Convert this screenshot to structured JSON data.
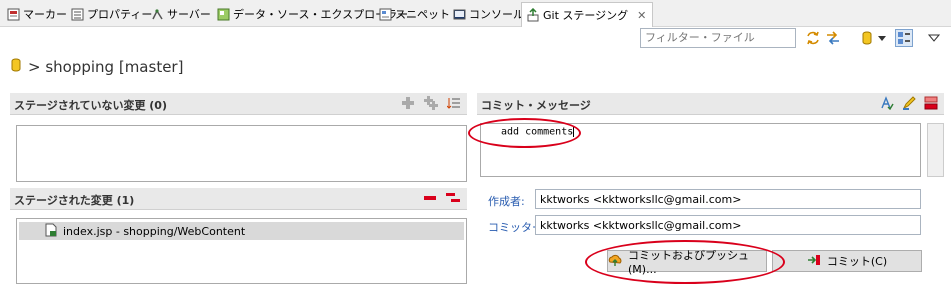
{
  "tabs": [
    {
      "label": "マーカー",
      "icon": "markers-icon"
    },
    {
      "label": "プロパティー",
      "icon": "properties-icon"
    },
    {
      "label": "サーバー",
      "icon": "servers-icon"
    },
    {
      "label": "データ・ソース・エクスプローラー",
      "icon": "data-source-icon"
    },
    {
      "label": "スニペット",
      "icon": "snippets-icon"
    },
    {
      "label": "コンソール",
      "icon": "console-icon"
    },
    {
      "label": "Git ステージング",
      "icon": "git-staging-icon",
      "active": true
    }
  ],
  "filter": {
    "placeholder": "フィルター・ファイル"
  },
  "repository": {
    "label": "> shopping [master]"
  },
  "unstaged": {
    "title": "ステージされていない変更 (0)"
  },
  "staged": {
    "title": "ステージされた変更 (1)",
    "items": [
      {
        "label": "index.jsp - shopping/WebContent"
      }
    ]
  },
  "commit": {
    "title": "コミット・メッセージ",
    "message": "add comments",
    "author_label": "作成者:",
    "author_value": "kktworks <kktworksllc@gmail.com>",
    "committer_label": "コミッター:",
    "committer_value": "kktworks <kktworksllc@gmail.com>",
    "commit_push_label": "コミットおよびプッシュ(M)...",
    "commit_label": "コミット(C)"
  },
  "colors": {
    "annotation_ring": "#d9001b",
    "link_label": "#2a5db0"
  }
}
